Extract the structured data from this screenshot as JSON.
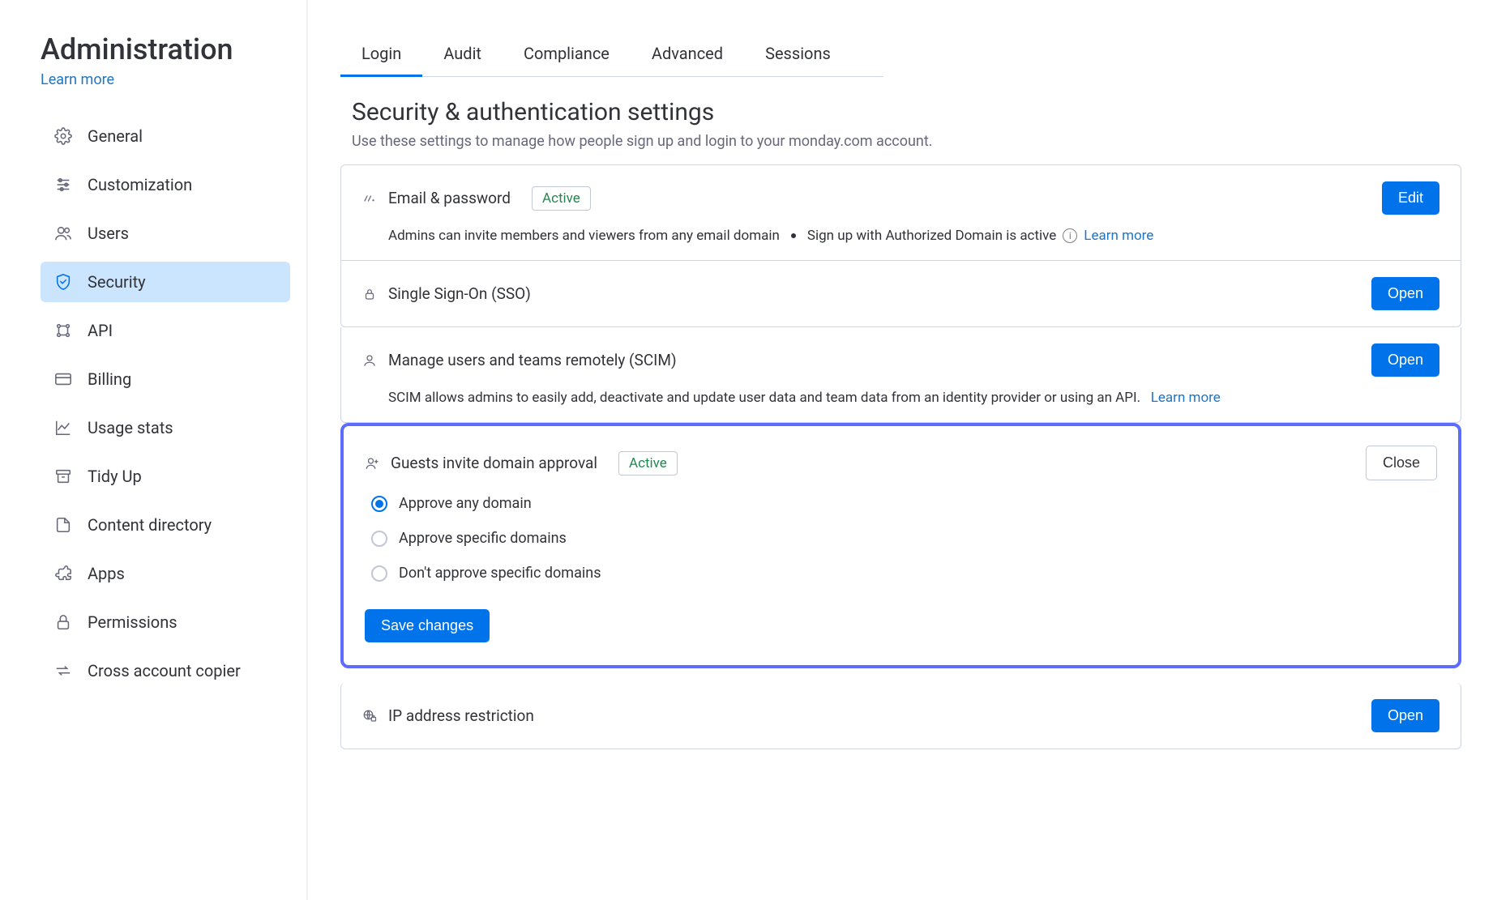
{
  "sidebar": {
    "title": "Administration",
    "learn_more": "Learn more",
    "items": [
      {
        "label": "General"
      },
      {
        "label": "Customization"
      },
      {
        "label": "Users"
      },
      {
        "label": "Security"
      },
      {
        "label": "API"
      },
      {
        "label": "Billing"
      },
      {
        "label": "Usage stats"
      },
      {
        "label": "Tidy Up"
      },
      {
        "label": "Content directory"
      },
      {
        "label": "Apps"
      },
      {
        "label": "Permissions"
      },
      {
        "label": "Cross account copier"
      }
    ]
  },
  "tabs": {
    "login": "Login",
    "audit": "Audit",
    "compliance": "Compliance",
    "advanced": "Advanced",
    "sessions": "Sessions"
  },
  "page": {
    "title": "Security & authentication settings",
    "subtitle": "Use these settings to manage how people sign up and login to your monday.com account."
  },
  "email_password": {
    "title": "Email & password",
    "badge": "Active",
    "btn": "Edit",
    "desc1": "Admins can invite members and viewers from any email domain",
    "desc2": "Sign up with Authorized Domain is active",
    "learn_more": "Learn more"
  },
  "sso": {
    "title": "Single Sign-On (SSO)",
    "btn": "Open"
  },
  "scim": {
    "title": "Manage users and teams remotely (SCIM)",
    "btn": "Open",
    "desc": "SCIM allows admins to easily add, deactivate and update user data and team data from an identity provider or using an API.",
    "learn_more": "Learn more"
  },
  "guests": {
    "title": "Guests invite domain approval",
    "badge": "Active",
    "btn": "Close",
    "options": {
      "any": "Approve any domain",
      "specific": "Approve specific domains",
      "dont": "Don't approve specific domains"
    },
    "save": "Save changes"
  },
  "ip": {
    "title": "IP address restriction",
    "btn": "Open"
  }
}
